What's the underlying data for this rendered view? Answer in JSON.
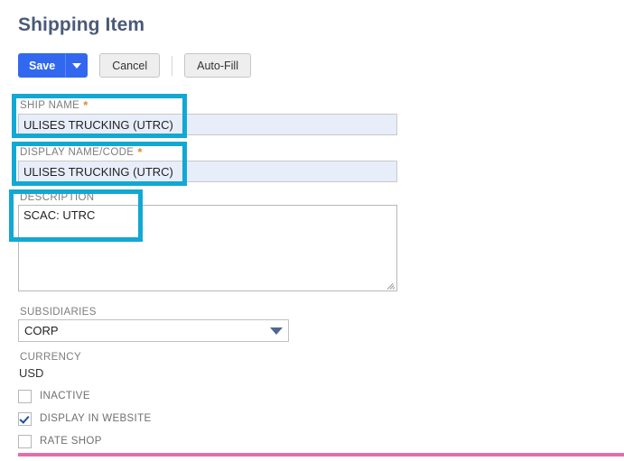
{
  "header": {
    "title": "Shipping Item"
  },
  "toolbar": {
    "save_label": "Save",
    "save_dropdown_icon": "chevron-down-icon",
    "cancel_label": "Cancel",
    "autofill_label": "Auto-Fill"
  },
  "form": {
    "ship_name": {
      "label": "SHIP NAME",
      "required_marker": "*",
      "value": "ULISES TRUCKING (UTRC)",
      "placeholder": ""
    },
    "display_name_code": {
      "label": "DISPLAY NAME/CODE",
      "required_marker": "*",
      "value": "ULISES TRUCKING (UTRC)",
      "placeholder": ""
    },
    "description": {
      "label": "DESCRIPTION",
      "value": "SCAC: UTRC",
      "placeholder": ""
    },
    "subsidiaries": {
      "label": "SUBSIDIARIES",
      "value": "CORP",
      "dropdown_icon": "caret-down-icon"
    },
    "currency": {
      "label": "CURRENCY",
      "value": "USD"
    },
    "checkboxes": [
      {
        "label": "INACTIVE",
        "checked": false
      },
      {
        "label": "DISPLAY IN WEBSITE",
        "checked": true
      },
      {
        "label": "RATE SHOP",
        "checked": false
      }
    ]
  },
  "annotations": {
    "highlight_color": "#12a8d4",
    "boxes": [
      {
        "name": "ship-name-highlight"
      },
      {
        "name": "display-name-code-highlight"
      },
      {
        "name": "description-highlight"
      }
    ]
  },
  "colors": {
    "title": "#4a5a78",
    "primary_button": "#3268ef",
    "input_background": "#e8edfa",
    "required_star": "#d98f2b",
    "bottom_rule": "#df70a8",
    "checkbox_check": "#1f4f9c",
    "dropdown_arrow": "#4f6792"
  }
}
